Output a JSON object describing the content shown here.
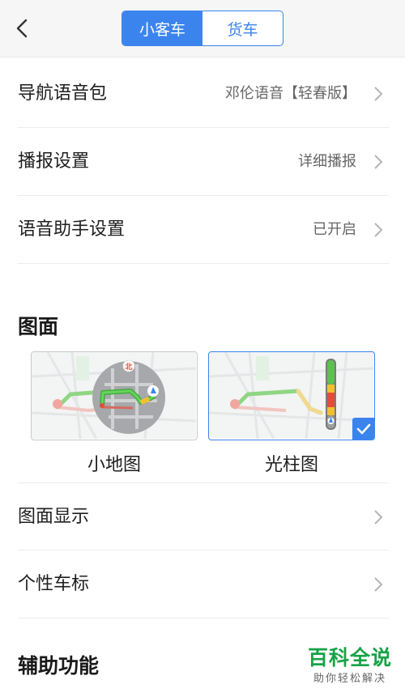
{
  "header": {
    "tabs": [
      {
        "label": "小客车",
        "active": true
      },
      {
        "label": "货车",
        "active": false
      }
    ],
    "back_icon": "chevron-left-icon"
  },
  "settings": [
    {
      "label": "导航语音包",
      "value": "邓伦语音【轻春版】"
    },
    {
      "label": "播报设置",
      "value": "详细播报"
    },
    {
      "label": "语音助手设置",
      "value": "已开启"
    }
  ],
  "display_section": {
    "title": "图面",
    "options": [
      {
        "label": "小地图",
        "selected": false
      },
      {
        "label": "光柱图",
        "selected": true
      }
    ],
    "compass_label": "北",
    "rows": [
      {
        "label": "图面显示"
      },
      {
        "label": "个性车标"
      }
    ]
  },
  "assist_section": {
    "title": "辅助功能"
  },
  "watermark": {
    "main": "百科全说",
    "sub": "助你轻松解决"
  },
  "colors": {
    "accent": "#3b84ee",
    "route_green": "#5cc14f",
    "route_yellow": "#f2c02f",
    "route_red": "#e54b3b",
    "watermark_green": "#17a347"
  }
}
